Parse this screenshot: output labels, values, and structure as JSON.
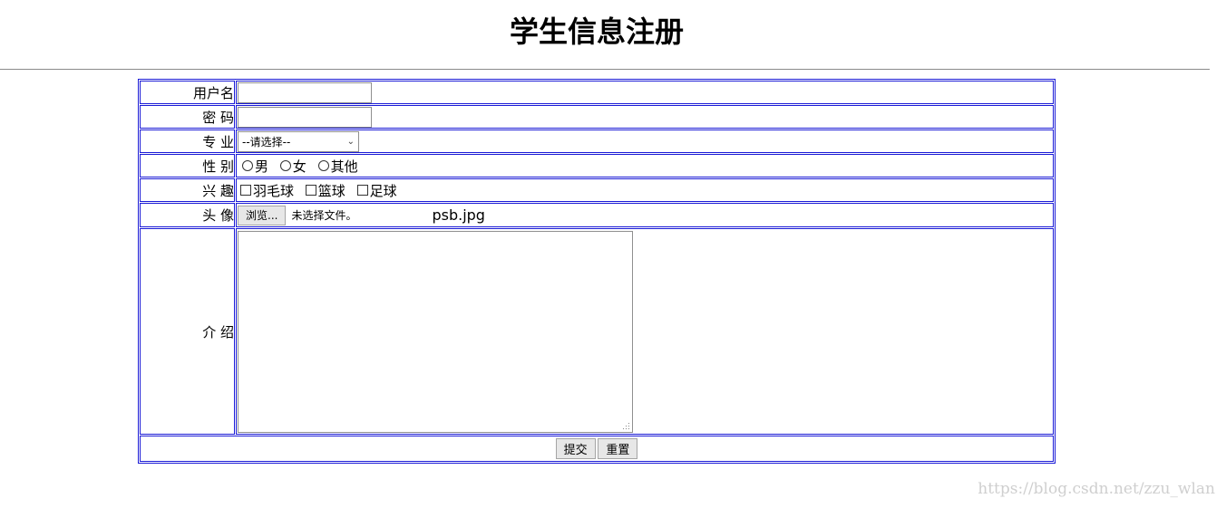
{
  "header": {
    "title": "学生信息注册"
  },
  "form": {
    "username": {
      "label": "用户名",
      "value": ""
    },
    "password": {
      "label": "密 码",
      "value": ""
    },
    "major": {
      "label": "专 业",
      "selected": "--请选择--"
    },
    "gender": {
      "label": "性 别",
      "options": [
        "男",
        "女",
        "其他"
      ]
    },
    "hobbies": {
      "label": "兴 趣",
      "options": [
        "羽毛球",
        "篮球",
        "足球"
      ]
    },
    "avatar": {
      "label": "头 像",
      "browse_label": "浏览...",
      "status": "未选择文件。",
      "file_name": "psb.jpg"
    },
    "intro": {
      "label": "介 绍",
      "value": ""
    },
    "submit_label": "提交",
    "reset_label": "重置"
  },
  "watermark": "https://blog.csdn.net/zzu_wlan",
  "colors": {
    "table_border": "#1a1ad6",
    "rule": "#8a8a8a"
  }
}
